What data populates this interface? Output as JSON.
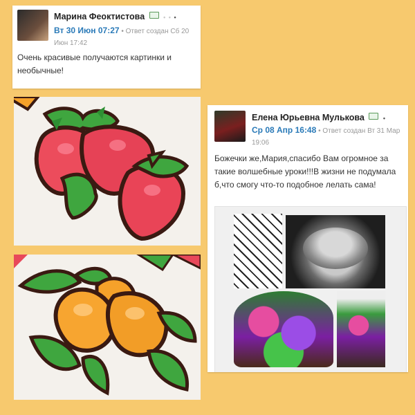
{
  "comment1": {
    "author": "Марина Феоктистова",
    "date": "Вт 30 Июн 07:27",
    "meta": "• Ответ создан Сб 20 Июн 17:42",
    "text": "Очень красивые получаются картинки и необычные!"
  },
  "comment2": {
    "author": "Елена Юрьевна Мулькова",
    "date": "Ср 08 Апр 16:48",
    "meta": "• Ответ создан Вт 31 Мар 19:06",
    "text": "Божечки же,Мария,спасибо Вам огромное за такие волшебные уроки!!!В жизни не подумала б,что смогу что-то подобное лелать сама!",
    "gallery_images": [
      "stencil-outline",
      "metal-bowl",
      "stained-glass-cake",
      "stained-glass-cake-side"
    ]
  },
  "icons": {
    "verified": "verified-badge-icon",
    "more": "more-dots-icon"
  },
  "colors": {
    "background": "#f7c96e",
    "date": "#2a7ab8",
    "strawberry": "#e8485a",
    "peach": "#f5a12a",
    "leaf": "#3fa63f",
    "outline": "#3a1a12"
  }
}
